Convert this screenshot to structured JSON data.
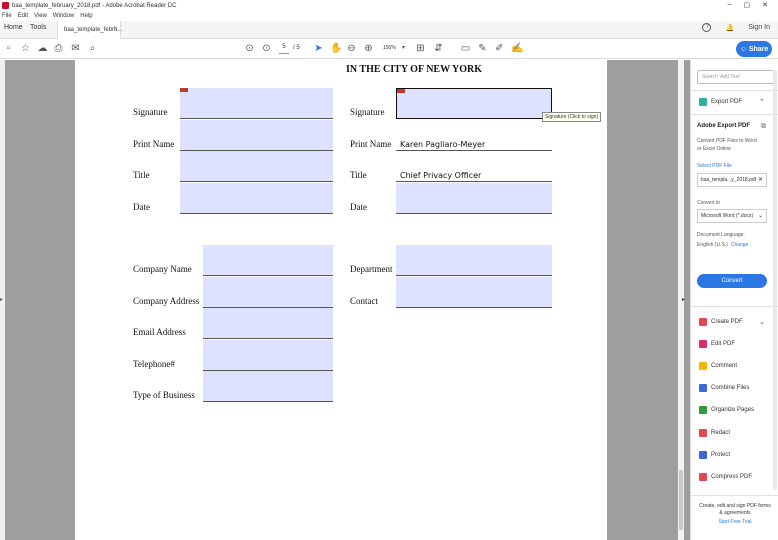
{
  "window": {
    "title": "baa_template_february_2018.pdf - Adobe Acrobat Reader DC",
    "min": "–",
    "max": "▢",
    "close": "✕"
  },
  "menu": [
    "File",
    "Edit",
    "View",
    "Window",
    "Help"
  ],
  "tabs": {
    "home": "Home",
    "tools": "Tools",
    "document": "baa_template_febru...",
    "close": "×",
    "signin": "Sign In"
  },
  "toolbar": {
    "page_current": "5",
    "page_total": "/ 5",
    "zoom": "150%"
  },
  "share": "Share",
  "document": {
    "heading": "IN THE CITY OF NEW YORK",
    "left_labels": [
      "Signature",
      "Print Name",
      "Title",
      "Date"
    ],
    "right_labels": [
      "Signature",
      "Print Name",
      "Title",
      "Date"
    ],
    "right_values": {
      "print_name": "Karen Pagliaro-Meyer",
      "title": "Chief Privacy Officer"
    },
    "company_labels": [
      "Company Name",
      "Company Address",
      "Email Address",
      "Telephone#",
      "Type of Business"
    ],
    "dept_labels": [
      "Department",
      "Contact"
    ],
    "tooltip": "Signature (Click to sign)"
  },
  "panel": {
    "search_placeholder": "Search 'Add Text'",
    "export_pdf": "Export PDF",
    "adobe_export": "Adobe Export PDF",
    "export_desc": "Convert PDF Files to Word or Excel Online",
    "select_file": "Select PDF File",
    "file_name": "baa_templa...y_2018.pdf",
    "convert_to": "Convert to",
    "format": "Microsoft Word (*.docx)",
    "doc_language": "Document Language:",
    "language": "English (U.S.)",
    "change": "Change",
    "convert": "Convert",
    "tools": [
      {
        "label": "Create PDF",
        "color": "#e34850"
      },
      {
        "label": "Edit PDF",
        "color": "#e1296f"
      },
      {
        "label": "Comment",
        "color": "#f2b705"
      },
      {
        "label": "Combine Files",
        "color": "#3d66d6"
      },
      {
        "label": "Organize Pages",
        "color": "#2e9d3e"
      },
      {
        "label": "Redact",
        "color": "#e34850"
      },
      {
        "label": "Protect",
        "color": "#3d66d6"
      },
      {
        "label": "Compress PDF",
        "color": "#e34850"
      }
    ],
    "promo": "Create, edit and sign PDF forms & agreements",
    "trial": "Start Free Trial"
  }
}
